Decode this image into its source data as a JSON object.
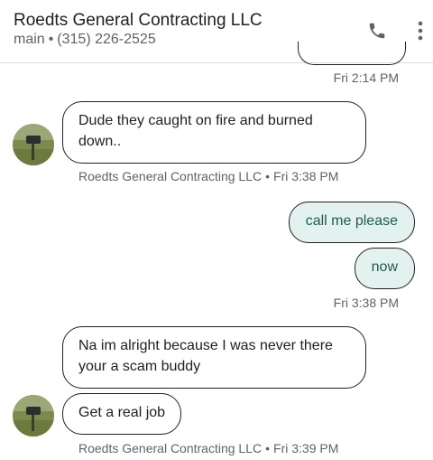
{
  "header": {
    "title": "Roedts General Contracting LLC",
    "line_type": "main",
    "separator": "•",
    "phone": "(315) 226-2525",
    "call_icon": "phone-icon",
    "menu_icon": "more-vert-icon"
  },
  "messages": {
    "ts1": "Fri 2:14 PM",
    "in1": "Dude they caught on fire and burned down..",
    "sender_name": "Roedts General Contracting LLC",
    "in1_time": "Fri 3:38 PM",
    "out1": "call me please",
    "out2": "now",
    "ts2": "Fri 3:38 PM",
    "in2": "Na im alright because I was never there your a scam buddy",
    "in3": "Get a real job",
    "in3_time": "Fri 3:39 PM"
  },
  "colors": {
    "outgoing_bubble": "#e3f2ef",
    "outgoing_text": "#1f5c4d",
    "secondary_text": "#5f6368"
  }
}
